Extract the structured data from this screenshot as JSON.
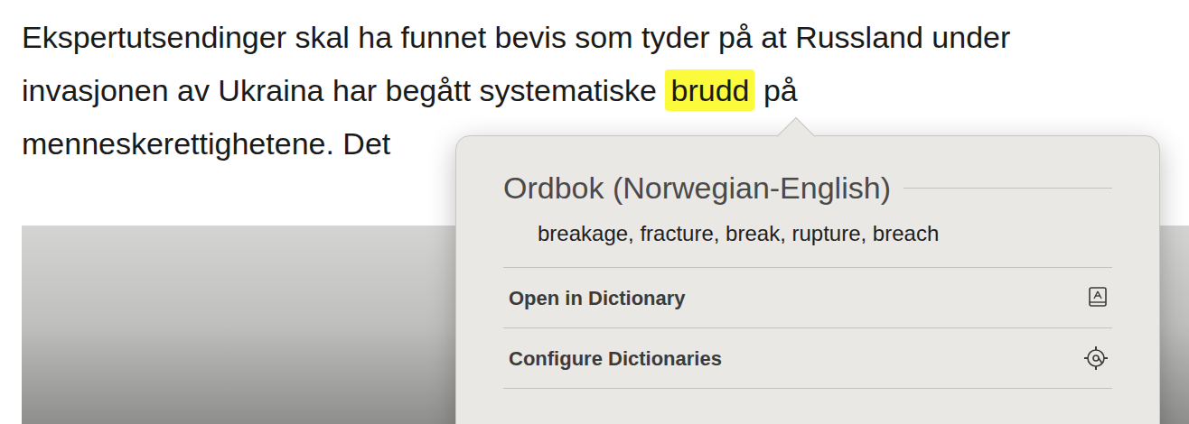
{
  "article": {
    "lines": [
      {
        "segments": [
          {
            "text": "Ekspertutsendinger skal ha funnet bevis som tyder på at Russland under",
            "highlighted": false
          }
        ]
      },
      {
        "segments": [
          {
            "text": "invasjonen av Ukraina har begått systematiske ",
            "highlighted": false
          },
          {
            "text": "brudd",
            "highlighted": true
          },
          {
            "text": " på",
            "highlighted": false
          }
        ]
      },
      {
        "segments": [
          {
            "text": "menneskerettighetene. Det",
            "highlighted": false
          }
        ]
      }
    ]
  },
  "popup": {
    "title": "Ordbok (Norwegian-English)",
    "definitions": "breakage, fracture, break, rupture, breach",
    "actions": [
      {
        "label": "Open in Dictionary"
      },
      {
        "label": "Configure Dictionaries"
      }
    ]
  }
}
